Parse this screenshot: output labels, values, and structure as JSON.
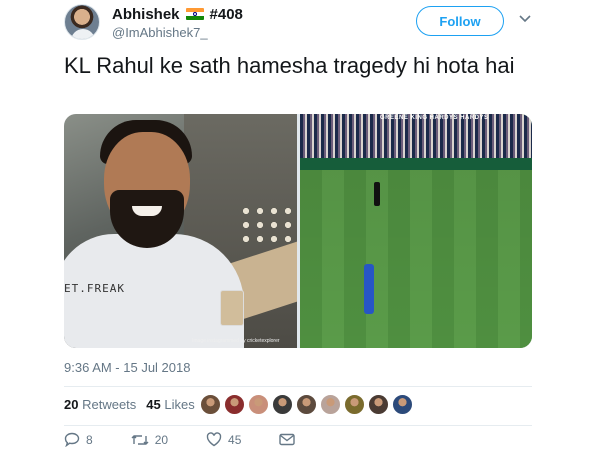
{
  "tweet": {
    "author": {
      "display_name": "Abhishek",
      "tag": "#408",
      "handle": "@ImAbhishek7_",
      "flag_icon": "india-flag-icon"
    },
    "follow_label": "Follow",
    "text": "KL Rahul ke sath hamesha tragedy hi hota hai",
    "media": {
      "left_photo_caption": "ET.FREAK",
      "left_photo_credit": "Image instagrammed by cricketexplorer",
      "right_photo_sponsor": "GREENE KING  HARDYS  HARDYS"
    },
    "timestamp": "9:36 AM - 15 Jul 2018",
    "stats": {
      "retweets_count": "20",
      "retweets_label": "Retweets",
      "likes_count": "45",
      "likes_label": "Likes"
    },
    "liker_colors": [
      "#6b4f3a",
      "#8a2d2d",
      "#c98f7a",
      "#3a3a3a",
      "#5c4a3d",
      "#b9a39a",
      "#7a6b2d",
      "#4a3b33",
      "#2c4a7a"
    ],
    "actions": {
      "reply_count": "8",
      "retweet_count": "20",
      "like_count": "45"
    },
    "colors": {
      "accent": "#1da1f2",
      "text_primary": "#14171a",
      "text_secondary": "#657786",
      "divider": "#e6ecf0"
    }
  }
}
